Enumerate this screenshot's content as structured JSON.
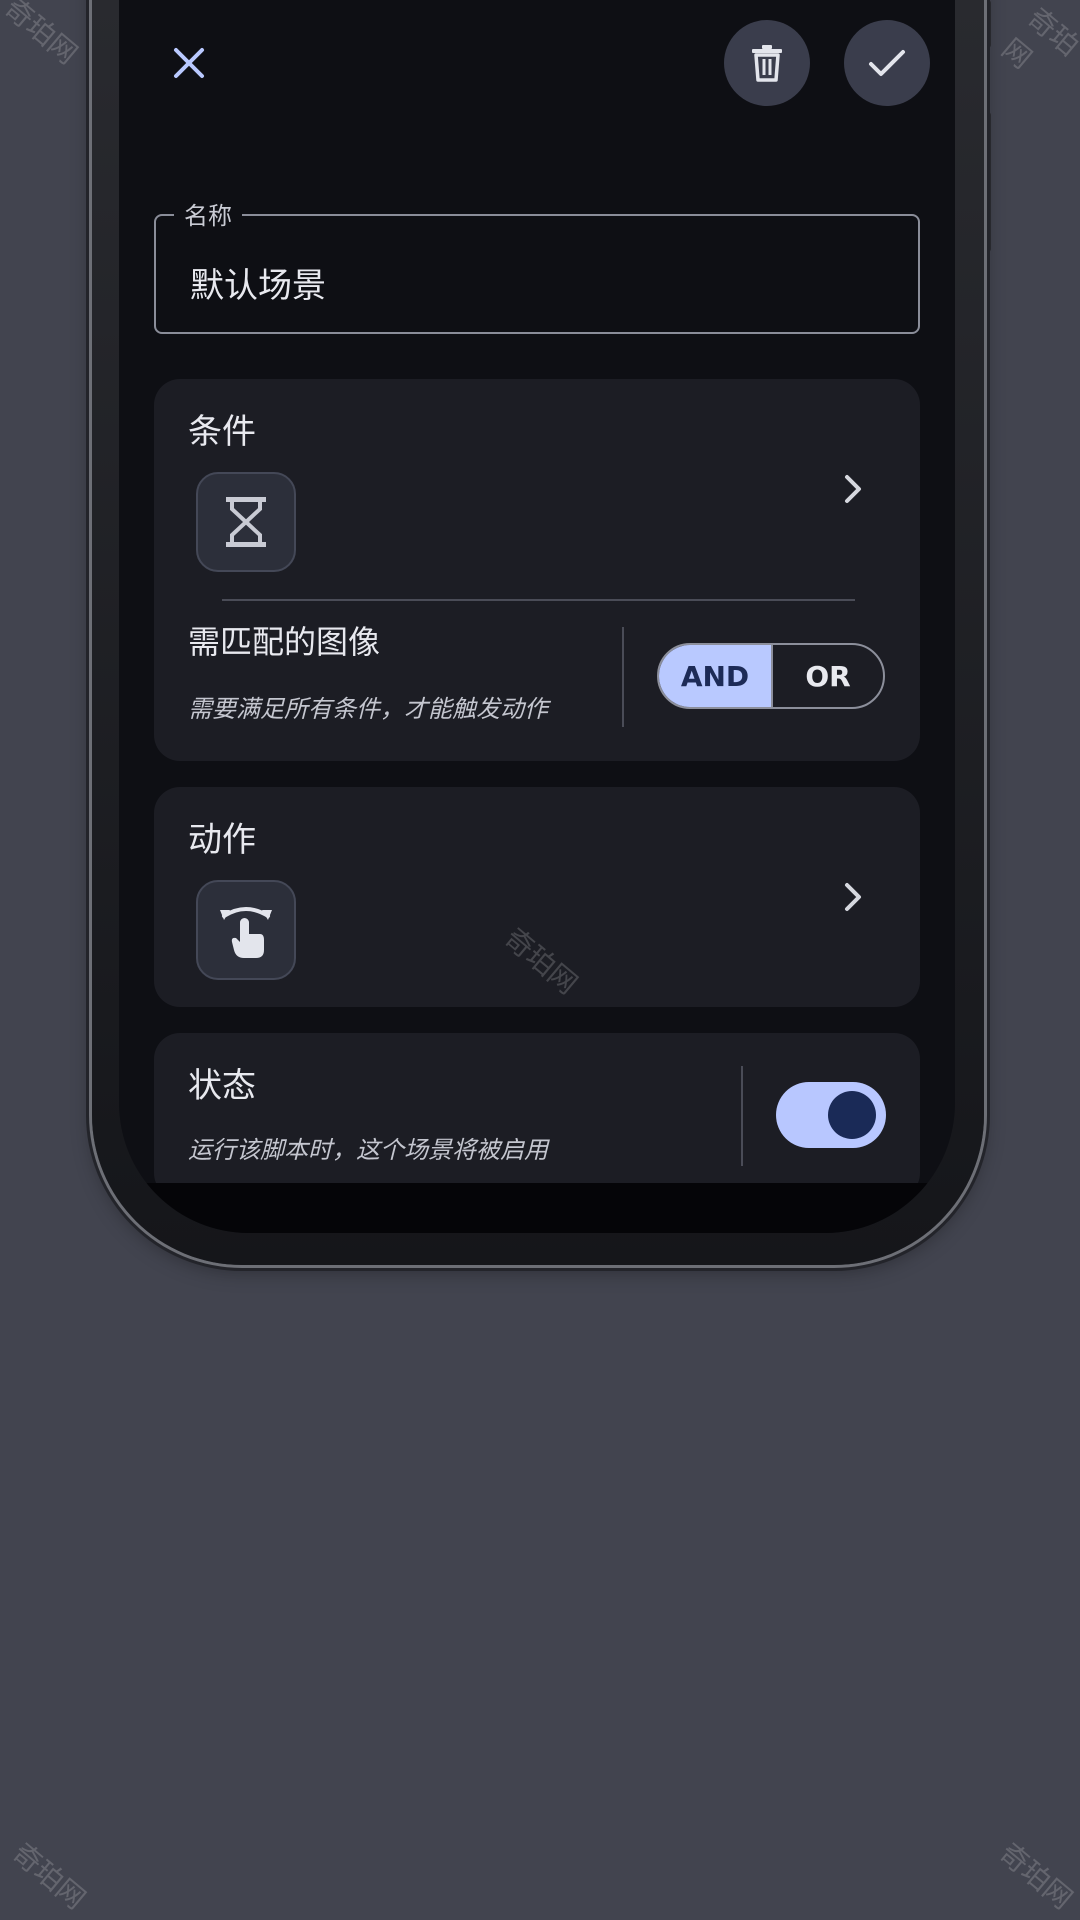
{
  "name_field": {
    "label": "名称",
    "value": "默认场景"
  },
  "conditions_card": {
    "title": "条件",
    "icon": "hourglass-icon",
    "match_title": "需匹配的图像",
    "match_desc": "需要满足所有条件，才能触发动作",
    "segment": {
      "and_label": "AND",
      "or_label": "OR",
      "selected": "AND"
    }
  },
  "actions_card": {
    "title": "动作",
    "icon": "tap-gesture-icon"
  },
  "status_card": {
    "title": "状态",
    "desc": "运行该脚本时，这个场景将被启用",
    "toggle_on": true
  },
  "watermark": "奇珀网",
  "colors": {
    "background": "#42444f",
    "screen": "#0e0f14",
    "card": "#1c1d24",
    "accent": "#b9c9ff",
    "accent_dark": "#1a2a57"
  }
}
